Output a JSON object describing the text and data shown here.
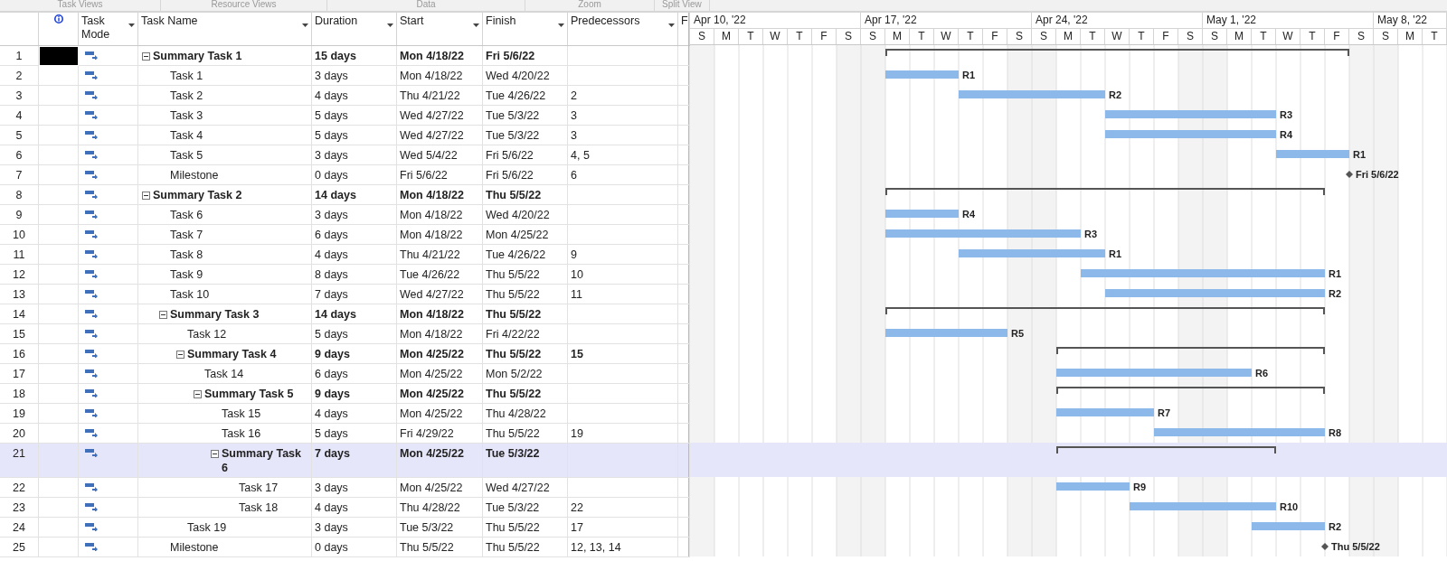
{
  "ribbon_groups": [
    "Task Views",
    "Resource Views",
    "Data",
    "Zoom",
    "Split View"
  ],
  "table": {
    "columns": [
      "Task Mode",
      "Task Name",
      "Duration",
      "Start",
      "Finish",
      "Predecessors",
      "F"
    ]
  },
  "tasks": [
    {
      "id": "1",
      "name": "Summary Task 1",
      "duration": "15 days",
      "start": "Mon 4/18/22",
      "finish": "Fri 5/6/22",
      "kind": "summary",
      "expanded": true,
      "selected": false,
      "redacted": true,
      "children": [
        {
          "id": "2",
          "name": "Task 1",
          "duration": "3 days",
          "start": "Mon 4/18/22",
          "finish": "Wed 4/20/22",
          "kind": "task",
          "selected": false,
          "redacted": false,
          "bar_label": "R1"
        },
        {
          "id": "3",
          "name": "Task 2",
          "duration": "4 days",
          "start": "Thu 4/21/22",
          "finish": "Tue 4/26/22",
          "predecessors": "2",
          "kind": "task",
          "selected": false,
          "redacted": false,
          "bar_label": "R2"
        },
        {
          "id": "4",
          "name": "Task 3",
          "duration": "5 days",
          "start": "Wed 4/27/22",
          "finish": "Tue 5/3/22",
          "predecessors": "3",
          "kind": "task",
          "selected": false,
          "redacted": false,
          "bar_label": "R3"
        },
        {
          "id": "5",
          "name": "Task 4",
          "duration": "5 days",
          "start": "Wed 4/27/22",
          "finish": "Tue 5/3/22",
          "predecessors": "3",
          "kind": "task",
          "selected": false,
          "redacted": false,
          "bar_label": "R4"
        },
        {
          "id": "6",
          "name": "Task 5",
          "duration": "3 days",
          "start": "Wed 5/4/22",
          "finish": "Fri 5/6/22",
          "predecessors": "4, 5",
          "kind": "task",
          "selected": false,
          "redacted": false,
          "bar_label": "R1"
        },
        {
          "id": "7",
          "name": "Milestone",
          "duration": "0 days",
          "start": "Fri 5/6/22",
          "finish": "Fri 5/6/22",
          "predecessors": "6",
          "kind": "milestone",
          "selected": false,
          "redacted": false,
          "bar_label": "Fri 5/6/22"
        }
      ]
    },
    {
      "id": "8",
      "name": "Summary Task 2",
      "duration": "14 days",
      "start": "Mon 4/18/22",
      "finish": "Thu 5/5/22",
      "kind": "summary",
      "expanded": true,
      "selected": false,
      "redacted": false,
      "children": [
        {
          "id": "9",
          "name": "Task 6",
          "duration": "3 days",
          "start": "Mon 4/18/22",
          "finish": "Wed 4/20/22",
          "kind": "task",
          "selected": false,
          "redacted": false,
          "bar_label": "R4"
        },
        {
          "id": "10",
          "name": "Task 7",
          "duration": "6 days",
          "start": "Mon 4/18/22",
          "finish": "Mon 4/25/22",
          "kind": "task",
          "selected": false,
          "redacted": false,
          "bar_label": "R3"
        },
        {
          "id": "11",
          "name": "Task 8",
          "duration": "4 days",
          "start": "Thu 4/21/22",
          "finish": "Tue 4/26/22",
          "predecessors": "9",
          "kind": "task",
          "selected": false,
          "redacted": false,
          "bar_label": "R1"
        },
        {
          "id": "12",
          "name": "Task 9",
          "duration": "8 days",
          "start": "Tue 4/26/22",
          "finish": "Thu 5/5/22",
          "predecessors": "10",
          "kind": "task",
          "selected": false,
          "redacted": false,
          "bar_label": "R1"
        },
        {
          "id": "13",
          "name": "Task 10",
          "duration": "7 days",
          "start": "Wed 4/27/22",
          "finish": "Thu 5/5/22",
          "predecessors": "11",
          "kind": "task",
          "selected": false,
          "redacted": false,
          "bar_label": "R2"
        },
        {
          "id": "14",
          "name": "Summary Task 3",
          "duration": "14 days",
          "start": "Mon 4/18/22",
          "finish": "Thu 5/5/22",
          "kind": "summary",
          "expanded": true,
          "selected": false,
          "redacted": false,
          "children": [
            {
              "id": "15",
              "name": "Task 12",
              "duration": "5 days",
              "start": "Mon 4/18/22",
              "finish": "Fri 4/22/22",
              "kind": "task",
              "selected": false,
              "redacted": false,
              "bar_label": "R5"
            },
            {
              "id": "16",
              "name": "Summary Task 4",
              "duration": "9 days",
              "start": "Mon 4/25/22",
              "finish": "Thu 5/5/22",
              "predecessors": "15",
              "kind": "summary",
              "expanded": true,
              "selected": false,
              "redacted": false,
              "children": [
                {
                  "id": "17",
                  "name": "Task 14",
                  "duration": "6 days",
                  "start": "Mon 4/25/22",
                  "finish": "Mon 5/2/22",
                  "kind": "task",
                  "selected": false,
                  "redacted": false,
                  "bar_label": "R6"
                },
                {
                  "id": "18",
                  "name": "Summary Task 5",
                  "duration": "9 days",
                  "start": "Mon 4/25/22",
                  "finish": "Thu 5/5/22",
                  "kind": "summary",
                  "expanded": true,
                  "selected": false,
                  "redacted": false,
                  "children": [
                    {
                      "id": "19",
                      "name": "Task 15",
                      "duration": "4 days",
                      "start": "Mon 4/25/22",
                      "finish": "Thu 4/28/22",
                      "kind": "task",
                      "selected": false,
                      "redacted": false,
                      "bar_label": "R7"
                    },
                    {
                      "id": "20",
                      "name": "Task 16",
                      "duration": "5 days",
                      "start": "Fri 4/29/22",
                      "finish": "Thu 5/5/22",
                      "predecessors": "19",
                      "kind": "task",
                      "selected": false,
                      "redacted": false,
                      "bar_label": "R8"
                    },
                    {
                      "id": "21",
                      "name": "Summary Task 6",
                      "duration": "7 days",
                      "start": "Mon 4/25/22",
                      "finish": "Tue 5/3/22",
                      "kind": "summary",
                      "expanded": true,
                      "selected": true,
                      "redacted": false,
                      "children": [
                        {
                          "id": "22",
                          "name": "Task 17",
                          "duration": "3 days",
                          "start": "Mon 4/25/22",
                          "finish": "Wed 4/27/22",
                          "kind": "task",
                          "selected": false,
                          "redacted": false,
                          "bar_label": "R9"
                        },
                        {
                          "id": "23",
                          "name": "Task 18",
                          "duration": "4 days",
                          "start": "Thu 4/28/22",
                          "finish": "Tue 5/3/22",
                          "predecessors": "22",
                          "kind": "task",
                          "selected": false,
                          "redacted": false,
                          "bar_label": "R10"
                        }
                      ]
                    }
                  ]
                }
              ]
            },
            {
              "id": "24",
              "name": "Task 19",
              "duration": "3 days",
              "start": "Tue 5/3/22",
              "finish": "Thu 5/5/22",
              "predecessors": "17",
              "kind": "task",
              "selected": false,
              "redacted": false,
              "bar_label": "R2"
            }
          ]
        },
        {
          "id": "25",
          "name": "Milestone",
          "duration": "0 days",
          "start": "Thu 5/5/22",
          "finish": "Thu 5/5/22",
          "predecessors": "12, 13, 14",
          "kind": "milestone",
          "selected": false,
          "redacted": false,
          "bar_label": "Thu 5/5/22"
        }
      ]
    }
  ],
  "timescale": {
    "weeks": [
      {
        "label": "Apr 10, '22",
        "days": [
          "S",
          "M",
          "T",
          "W",
          "T",
          "F",
          "S"
        ]
      },
      {
        "label": "Apr 17, '22",
        "days": [
          "S",
          "M",
          "T",
          "W",
          "T",
          "F",
          "S"
        ]
      },
      {
        "label": "Apr 24, '22",
        "days": [
          "S",
          "M",
          "T",
          "W",
          "T",
          "F",
          "S"
        ]
      },
      {
        "label": "May 1, '22",
        "days": [
          "S",
          "M",
          "T",
          "W",
          "T",
          "F",
          "S"
        ]
      },
      {
        "label": "May 8, '22",
        "days": [
          "S",
          "M",
          "T"
        ]
      }
    ]
  }
}
